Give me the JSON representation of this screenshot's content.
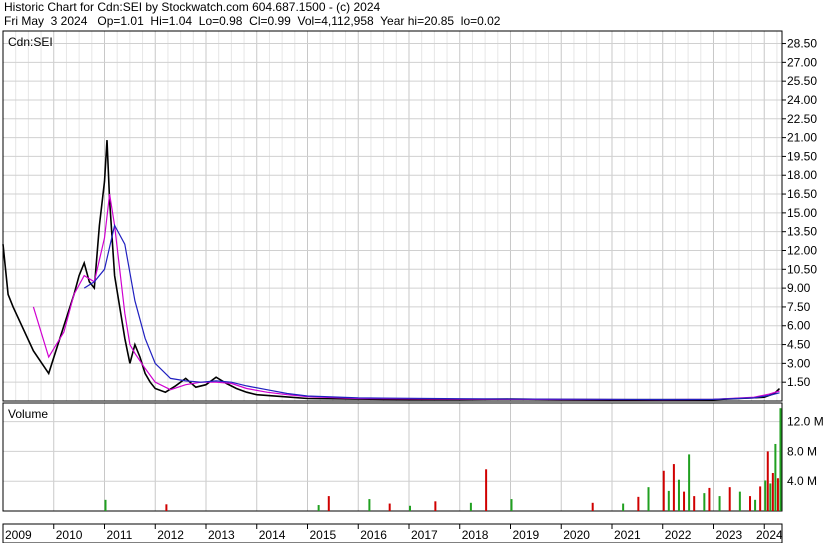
{
  "header": {
    "line1": "Historic Chart for Cdn:SEI by Stockwatch.com 604.687.1500 - (c) 2024",
    "line2": "Fri May  3 2024   Op=1.01  Hi=1.04  Lo=0.98  Cl=0.99  Vol=4,112,958  Year hi=20.85  lo=0.02"
  },
  "chart_data": [
    {
      "type": "line",
      "title": "Cdn:SEI",
      "xlabel": "",
      "ylabel": "",
      "ylim": [
        0,
        29.5
      ],
      "y_ticks": [
        "1.50",
        "3.00",
        "4.50",
        "6.00",
        "7.50",
        "9.00",
        "10.50",
        "12.00",
        "13.50",
        "15.00",
        "16.50",
        "18.00",
        "19.50",
        "21.00",
        "22.50",
        "24.00",
        "25.50",
        "27.00",
        "28.50"
      ],
      "x_ticks": [
        "2009",
        "2010",
        "2011",
        "2012",
        "2013",
        "2014",
        "2015",
        "2016",
        "2017",
        "2018",
        "2019",
        "2020",
        "2021",
        "2022",
        "2023",
        "2024"
      ],
      "grid": true,
      "series": [
        {
          "name": "",
          "color": "#000000",
          "x": [
            2009.0,
            2009.1,
            2009.2,
            2009.6,
            2009.9,
            2010.2,
            2010.4,
            2010.5,
            2010.6,
            2010.7,
            2010.8,
            2010.9,
            2011.0,
            2011.05,
            2011.1,
            2011.15,
            2011.2,
            2011.3,
            2011.4,
            2011.5,
            2011.6,
            2011.7,
            2011.8,
            2011.9,
            2012.0,
            2012.2,
            2012.4,
            2012.6,
            2012.8,
            2013.0,
            2013.2,
            2013.4,
            2013.6,
            2013.8,
            2014.0,
            2014.5,
            2015.0,
            2016.0,
            2017.0,
            2018.0,
            2019.0,
            2020.0,
            2021.0,
            2022.0,
            2023.0,
            2023.5,
            2024.0,
            2024.2,
            2024.3
          ],
          "values": [
            12.5,
            8.5,
            7.5,
            4.0,
            2.2,
            6.0,
            8.5,
            10.0,
            11.0,
            9.5,
            9.0,
            14.0,
            17.5,
            20.8,
            16.0,
            13.0,
            10.0,
            7.5,
            5.0,
            3.0,
            4.5,
            3.5,
            2.2,
            1.5,
            1.0,
            0.7,
            1.2,
            1.8,
            1.1,
            1.3,
            1.9,
            1.4,
            1.0,
            0.7,
            0.5,
            0.35,
            0.2,
            0.15,
            0.12,
            0.12,
            0.15,
            0.12,
            0.1,
            0.1,
            0.1,
            0.2,
            0.3,
            0.6,
            0.99
          ]
        },
        {
          "name": "",
          "color": "#d000d0",
          "x": [
            2009.6,
            2009.9,
            2010.2,
            2010.4,
            2010.6,
            2010.8,
            2011.0,
            2011.1,
            2011.2,
            2011.3,
            2011.4,
            2011.5,
            2011.6,
            2011.8,
            2012.0,
            2012.3,
            2012.6,
            2012.9,
            2013.2,
            2013.5,
            2013.8,
            2014.2,
            2014.6,
            2015.0,
            2016.0,
            2018.0,
            2020.0,
            2022.0,
            2023.0,
            2023.8,
            2024.1,
            2024.3
          ],
          "values": [
            7.5,
            3.5,
            5.5,
            8.5,
            10.0,
            9.5,
            13.0,
            16.5,
            14.0,
            10.5,
            7.0,
            4.5,
            3.8,
            2.6,
            1.5,
            0.9,
            1.3,
            1.5,
            1.5,
            1.4,
            1.0,
            0.7,
            0.5,
            0.35,
            0.2,
            0.15,
            0.12,
            0.11,
            0.13,
            0.3,
            0.55,
            0.8
          ]
        },
        {
          "name": "",
          "color": "#2020c0",
          "x": [
            2010.6,
            2010.8,
            2011.0,
            2011.2,
            2011.4,
            2011.6,
            2011.8,
            2012.0,
            2012.3,
            2012.6,
            2012.9,
            2013.2,
            2013.5,
            2013.8,
            2014.2,
            2014.6,
            2015.0,
            2016.0,
            2018.0,
            2020.0,
            2022.0,
            2023.0,
            2023.8,
            2024.1,
            2024.3
          ],
          "values": [
            9.0,
            9.5,
            10.5,
            14.0,
            12.5,
            8.0,
            5.0,
            3.0,
            1.8,
            1.6,
            1.5,
            1.6,
            1.5,
            1.2,
            0.9,
            0.6,
            0.4,
            0.25,
            0.18,
            0.14,
            0.12,
            0.13,
            0.25,
            0.45,
            0.65
          ]
        }
      ]
    },
    {
      "type": "bar",
      "title": "Volume",
      "ylabel": "",
      "ylim": [
        0,
        14.5
      ],
      "y_ticks": [
        "4.0 M",
        "8.0 M",
        "12.0 M"
      ],
      "x": [
        2011.0,
        2012.2,
        2015.2,
        2015.4,
        2016.2,
        2016.6,
        2017.0,
        2017.5,
        2018.2,
        2018.5,
        2019.0,
        2020.6,
        2021.2,
        2021.5,
        2021.7,
        2022.0,
        2022.1,
        2022.2,
        2022.3,
        2022.4,
        2022.5,
        2022.6,
        2022.8,
        2022.9,
        2023.1,
        2023.3,
        2023.5,
        2023.7,
        2023.8,
        2023.9,
        2024.0,
        2024.05,
        2024.1,
        2024.15,
        2024.2,
        2024.25,
        2024.3
      ],
      "values": [
        1.5,
        0.9,
        0.8,
        2.0,
        1.6,
        1.0,
        0.7,
        1.3,
        1.1,
        5.6,
        1.6,
        1.1,
        1.0,
        1.9,
        3.2,
        5.4,
        2.7,
        6.3,
        4.2,
        2.6,
        7.6,
        2.0,
        2.4,
        3.1,
        2.0,
        3.2,
        2.6,
        2.0,
        1.5,
        3.3,
        4.1,
        8.0,
        3.7,
        5.1,
        9.0,
        4.4,
        13.8
      ]
    }
  ]
}
